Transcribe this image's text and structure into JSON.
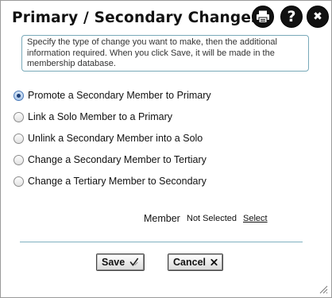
{
  "dialog": {
    "title": "Primary / Secondary Changes",
    "header_icons": [
      "print-icon",
      "help-icon",
      "close-icon"
    ],
    "help_glyph": "?",
    "close_glyph": "✖"
  },
  "instructions": "Specify the type of change you want to make, then the additional information required. When you click Save, it will be made in the membership database.",
  "options": [
    {
      "label": "Promote a Secondary Member to Primary",
      "checked": true
    },
    {
      "label": "Link a Solo Member to a Primary",
      "checked": false
    },
    {
      "label": "Unlink a Secondary Member into a Solo",
      "checked": false
    },
    {
      "label": "Change a Secondary Member to Tertiary",
      "checked": false
    },
    {
      "label": "Change a Tertiary Member to Secondary",
      "checked": false
    }
  ],
  "member": {
    "label": "Member",
    "value": "Not Selected",
    "select_link": "Select"
  },
  "buttons": {
    "save_label": "Save",
    "save_icon": "checkmark-icon",
    "cancel_label": "Cancel",
    "cancel_icon": "x-icon"
  },
  "colors": {
    "accent_border": "#79a9b9",
    "radio_checked": "#4a79b8"
  }
}
